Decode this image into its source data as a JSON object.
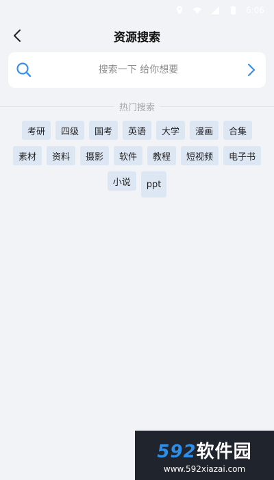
{
  "status_bar": {
    "time": "6:06"
  },
  "header": {
    "title": "资源搜索"
  },
  "search": {
    "placeholder": "搜索一下 给你想要",
    "value": ""
  },
  "hot": {
    "title": "热门搜索",
    "tags": [
      "考研",
      "四级",
      "国考",
      "英语",
      "大学",
      "漫画",
      "合集",
      "素材",
      "资料",
      "摄影",
      "软件",
      "教程",
      "短视频",
      "电子书",
      "小说",
      "ppt"
    ]
  },
  "watermark": {
    "logo_num": "592",
    "logo_text": "软件园",
    "url": "www.592xiazai.com"
  },
  "colors": {
    "accent": "#3a8ee6",
    "tag_bg": "#dde6f3",
    "background": "#f2f3f6"
  }
}
